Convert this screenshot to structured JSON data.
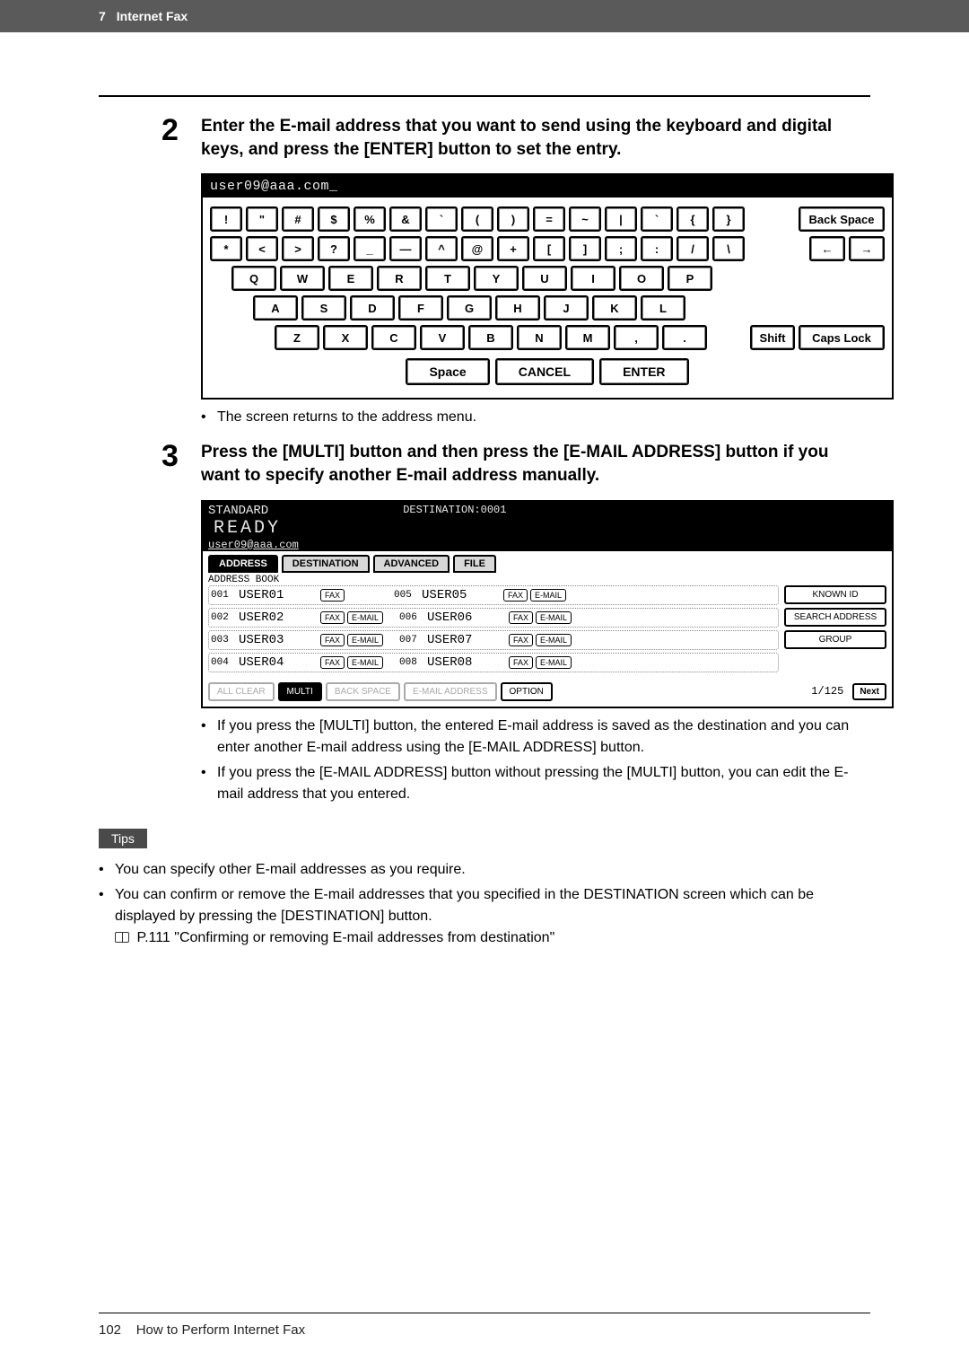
{
  "header": {
    "chapter_num": "7",
    "chapter_title": "Internet Fax"
  },
  "step2": {
    "num": "2",
    "text": "Enter the E-mail address that you want to send using the keyboard and digital keys, and press the [ENTER] button to set the entry.",
    "inputText": "user09@aaa.com_",
    "row1": [
      "!",
      "\"",
      "#",
      "$",
      "%",
      "&",
      "`",
      "(",
      ")",
      "=",
      "~",
      "|",
      "`",
      "{",
      "}"
    ],
    "row1_backspace": "Back Space",
    "row2": [
      "*",
      "<",
      ">",
      "?",
      "_",
      "—",
      "^",
      "@",
      "+",
      "[",
      "]",
      ";",
      ":",
      "/",
      "\\"
    ],
    "row2_left": "←",
    "row2_right": "→",
    "row3": [
      "Q",
      "W",
      "E",
      "R",
      "T",
      "Y",
      "U",
      "I",
      "O",
      "P"
    ],
    "row4": [
      "A",
      "S",
      "D",
      "F",
      "G",
      "H",
      "J",
      "K",
      "L"
    ],
    "row5": [
      "Z",
      "X",
      "C",
      "V",
      "B",
      "N",
      "M",
      ",",
      "."
    ],
    "row5_shift": "Shift",
    "row5_caps": "Caps Lock",
    "space": "Space",
    "cancel": "CANCEL",
    "enter": "ENTER",
    "note": "The screen returns to the address menu."
  },
  "step3": {
    "num": "3",
    "text": "Press the [MULTI] button and then press the [E-MAIL ADDRESS] button if you want to specify another E-mail address manually.",
    "ab": {
      "standard": "STANDARD",
      "destLabel": "DESTINATION:0001",
      "ready": "READY",
      "emailLine": "user09@aaa.com",
      "tabs": [
        "ADDRESS",
        "DESTINATION",
        "ADVANCED",
        "FILE"
      ],
      "bookLabel": "ADDRESS BOOK",
      "rows": [
        {
          "id": "001",
          "name": "USER01",
          "fax": "FAX",
          "email": "",
          "id2": "005",
          "name2": "USER05",
          "fax2": "FAX",
          "email2": "E-MAIL"
        },
        {
          "id": "002",
          "name": "USER02",
          "fax": "FAX",
          "email": "E-MAIL",
          "id2": "006",
          "name2": "USER06",
          "fax2": "FAX",
          "email2": "E-MAIL"
        },
        {
          "id": "003",
          "name": "USER03",
          "fax": "FAX",
          "email": "E-MAIL",
          "id2": "007",
          "name2": "USER07",
          "fax2": "FAX",
          "email2": "E-MAIL"
        },
        {
          "id": "004",
          "name": "USER04",
          "fax": "FAX",
          "email": "E-MAIL",
          "id2": "008",
          "name2": "USER08",
          "fax2": "FAX",
          "email2": "E-MAIL"
        }
      ],
      "side": [
        "KNOWN ID",
        "SEARCH ADDRESS",
        "GROUP"
      ],
      "bottom": {
        "allclear": "ALL CLEAR",
        "multi": "MULTI",
        "backspace": "BACK SPACE",
        "emailaddr": "E-MAIL ADDRESS",
        "option": "OPTION",
        "page": "1/125",
        "next": "Next"
      }
    },
    "notes": [
      "If you press the [MULTI] button, the entered E-mail address is saved as the destination and you can enter another E-mail address using the [E-MAIL ADDRESS] button.",
      "If you press the [E-MAIL ADDRESS] button without pressing the [MULTI] button, you can edit the E-mail address that you entered."
    ]
  },
  "tips": {
    "label": "Tips",
    "items": [
      "You can specify other E-mail addresses as you require.",
      "You can confirm or remove the E-mail addresses that you specified in the DESTINATION screen which can be displayed by pressing the [DESTINATION] button."
    ],
    "ref": "P.111 \"Confirming or removing E-mail addresses from destination\""
  },
  "footer": {
    "page": "102",
    "section": "How to Perform Internet Fax"
  }
}
